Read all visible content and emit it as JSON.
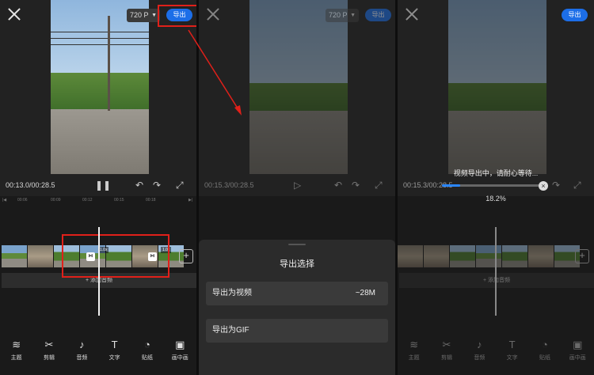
{
  "panel1": {
    "resolution": "720 P",
    "export_label": "导出",
    "time": "00:13.0/00:28.5",
    "ruler": [
      "00:06",
      "·",
      "00:09",
      "·",
      "00:12",
      "·",
      "00:15",
      "·",
      "00:18",
      "·",
      "00:21"
    ],
    "speed_badges": [
      "1.0x",
      "1.0x"
    ],
    "add_audio": "+ 添加音频",
    "tabs": [
      {
        "icon": "layers-icon",
        "glyph": "≋",
        "label": "主题"
      },
      {
        "icon": "scissors-icon",
        "glyph": "✂",
        "label": "剪辑"
      },
      {
        "icon": "music-icon",
        "glyph": "♪",
        "label": "音频"
      },
      {
        "icon": "text-icon",
        "glyph": "T",
        "label": "文字"
      },
      {
        "icon": "sticker-icon",
        "glyph": "◔",
        "label": "贴纸"
      },
      {
        "icon": "pip-icon",
        "glyph": "▣",
        "label": "画中画"
      }
    ]
  },
  "panel2": {
    "resolution": "720 P",
    "export_label": "导出",
    "time": "00:15.3/00:28.5",
    "sheet_title": "导出选择",
    "option_video": "导出为视频",
    "option_video_size": "~28M",
    "option_gif": "导出为GIF"
  },
  "panel3": {
    "export_label": "导出",
    "time": "00:15.3/00:28.5",
    "progress_text": "视频导出中，请耐心等待...",
    "progress_value": 0.182,
    "percent": "18.2%",
    "add_audio": "+ 添加音频",
    "tabs": [
      {
        "icon": "layers-icon",
        "glyph": "≋",
        "label": "主题"
      },
      {
        "icon": "scissors-icon",
        "glyph": "✂",
        "label": "剪辑"
      },
      {
        "icon": "music-icon",
        "glyph": "♪",
        "label": "音频"
      },
      {
        "icon": "text-icon",
        "glyph": "T",
        "label": "文字"
      },
      {
        "icon": "sticker-icon",
        "glyph": "◔",
        "label": "贴纸"
      },
      {
        "icon": "pip-icon",
        "glyph": "▣",
        "label": "画中画"
      }
    ]
  },
  "colors": {
    "accent": "#1c6ee8",
    "highlight_box": "#e0201a",
    "progress": "#2a86ff"
  }
}
